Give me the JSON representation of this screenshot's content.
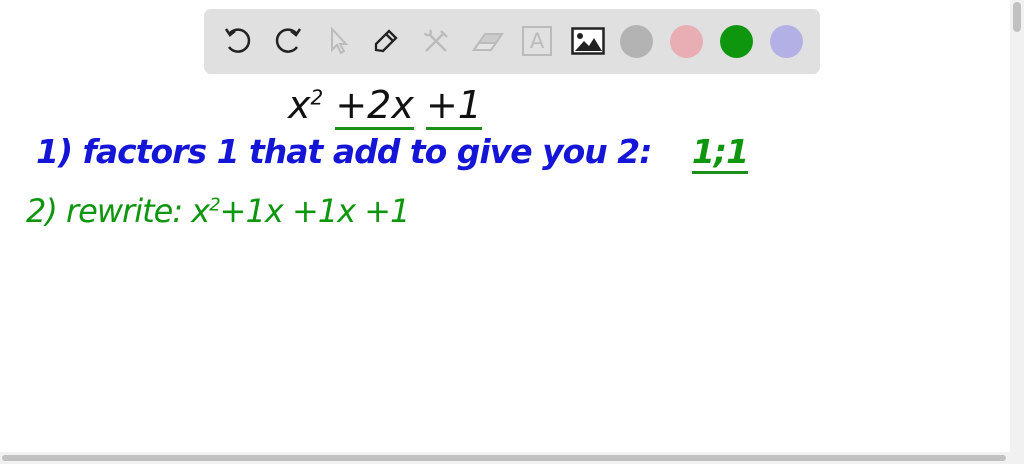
{
  "toolbar": {
    "tools": [
      {
        "name": "undo-icon",
        "enabled": true
      },
      {
        "name": "redo-icon",
        "enabled": true
      },
      {
        "name": "select-icon",
        "enabled": false
      },
      {
        "name": "pen-icon",
        "enabled": true
      },
      {
        "name": "tools-icon",
        "enabled": false
      },
      {
        "name": "eraser-icon",
        "enabled": false
      },
      {
        "name": "text-icon",
        "enabled": false
      },
      {
        "name": "image-icon",
        "enabled": true
      }
    ],
    "text_tool_glyph": "A",
    "colors": [
      "#b3b3b3",
      "#e8aeb4",
      "#0e960e",
      "#b3b0e6"
    ]
  },
  "canvas": {
    "expression": {
      "base": "x",
      "exp": "2",
      "term2": "+2x",
      "term3": "+1"
    },
    "step1": {
      "label": "1) factors 1 that add to give you 2:",
      "answer": "1;1"
    },
    "step2": {
      "label": "2) rewrite:",
      "expr_base": "x",
      "expr_exp": "2",
      "expr_rest": "+1x +1x +1"
    }
  }
}
